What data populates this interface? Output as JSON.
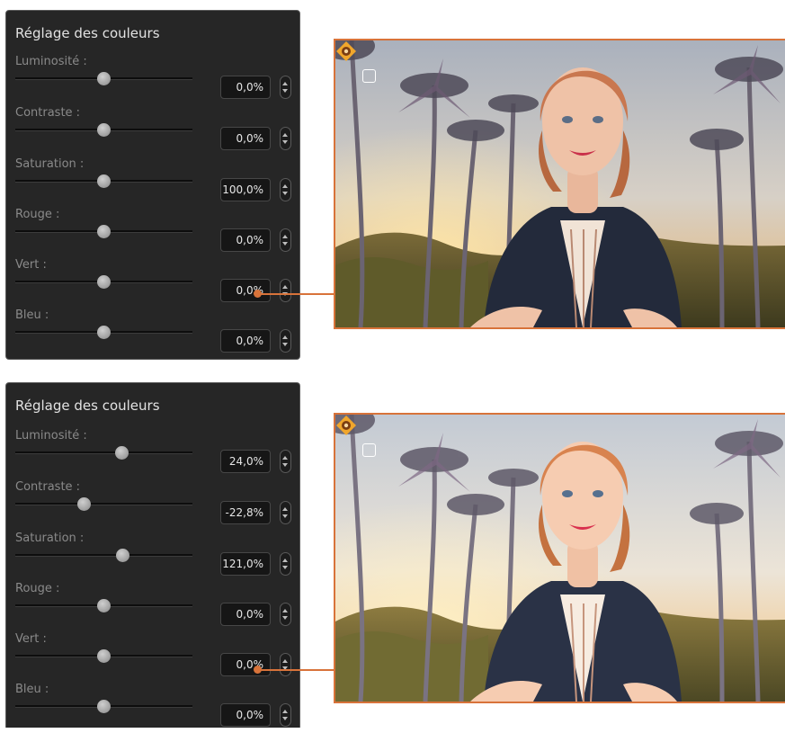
{
  "panels": [
    {
      "title": "Réglage des couleurs",
      "controls": [
        {
          "label": "Luminosité :",
          "value": "0,0%",
          "level": 0.5
        },
        {
          "label": "Contraste :",
          "value": "0,0%",
          "level": 0.5
        },
        {
          "label": "Saturation :",
          "value": "100,0%",
          "level": 0.5
        },
        {
          "label": "Rouge :",
          "value": "0,0%",
          "level": 0.5
        },
        {
          "label": "Vert :",
          "value": "0,0%",
          "level": 0.5
        },
        {
          "label": "Bleu :",
          "value": "0,0%",
          "level": 0.5
        }
      ]
    },
    {
      "title": "Réglage des couleurs",
      "controls": [
        {
          "label": "Luminosité :",
          "value": "24,0%",
          "level": 0.6
        },
        {
          "label": "Contraste :",
          "value": "-22,8%",
          "level": 0.386
        },
        {
          "label": "Saturation :",
          "value": "121,0%",
          "level": 0.605
        },
        {
          "label": "Rouge :",
          "value": "0,0%",
          "level": 0.5
        },
        {
          "label": "Vert :",
          "value": "0,0%",
          "level": 0.5
        },
        {
          "label": "Bleu :",
          "value": "0,0%",
          "level": 0.5
        }
      ]
    }
  ],
  "previews": [
    {
      "image": "presenter-with-palm-trees-original"
    },
    {
      "image": "presenter-with-palm-trees-adjusted"
    }
  ],
  "colors": {
    "accent": "#d8733a",
    "panel_bg": "#262626",
    "field_bg": "#161616",
    "label": "#8a8a8a",
    "text": "#e6e6e6"
  }
}
